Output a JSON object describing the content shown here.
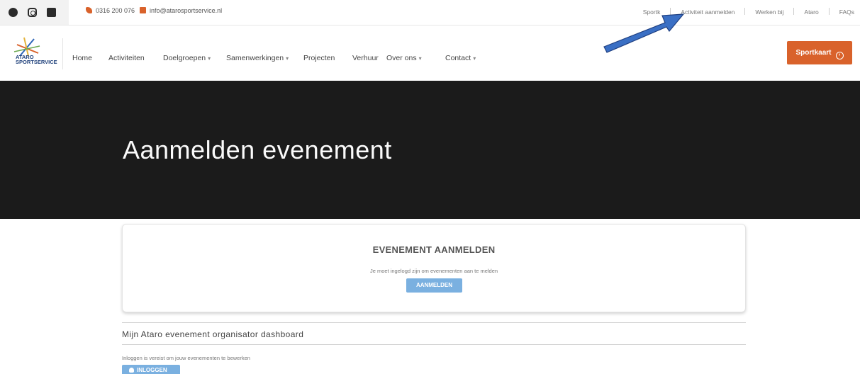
{
  "topbar": {
    "social_icons": [
      "facebook-icon",
      "instagram-icon",
      "linkedin-icon"
    ],
    "phone": "0316 200 076",
    "email": "info@atarosportservice.nl",
    "links": [
      "Sportk",
      "Activiteit aanmelden",
      "Werken bij",
      "Ataro",
      "FAQs"
    ]
  },
  "logo": {
    "line1": "ATARO",
    "line2": "SPORTSERVICE"
  },
  "nav": {
    "items": [
      {
        "label": "Home",
        "dropdown": false
      },
      {
        "label": "Activiteiten",
        "dropdown": false
      },
      {
        "label": "Doelgroepen",
        "dropdown": true
      },
      {
        "label": "Samenwerkingen",
        "dropdown": true
      },
      {
        "label": "Projecten",
        "dropdown": false
      },
      {
        "label": "Verhuur",
        "dropdown": false
      },
      {
        "label": "Over ons",
        "dropdown": true
      },
      {
        "label": "Contact",
        "dropdown": true
      }
    ],
    "cta_label": "Sportkaart"
  },
  "hero": {
    "title": "Aanmelden evenement"
  },
  "card": {
    "title": "EVENEMENT AANMELDEN",
    "message": "Je moet ingelogd zijn om evenementen aan te melden",
    "button_label": "AANMELDEN"
  },
  "dashboard": {
    "title": "Mijn Ataro evenement organisator dashboard",
    "note": "Inloggen is vereist om jouw evenementen te bewerken",
    "login_label": "INLOGGEN"
  },
  "colors": {
    "accent": "#d9622b",
    "hero_bg": "#1b1b1b",
    "button_blue": "#7ab0e0",
    "annotation_arrow": "#3a6fc4"
  }
}
